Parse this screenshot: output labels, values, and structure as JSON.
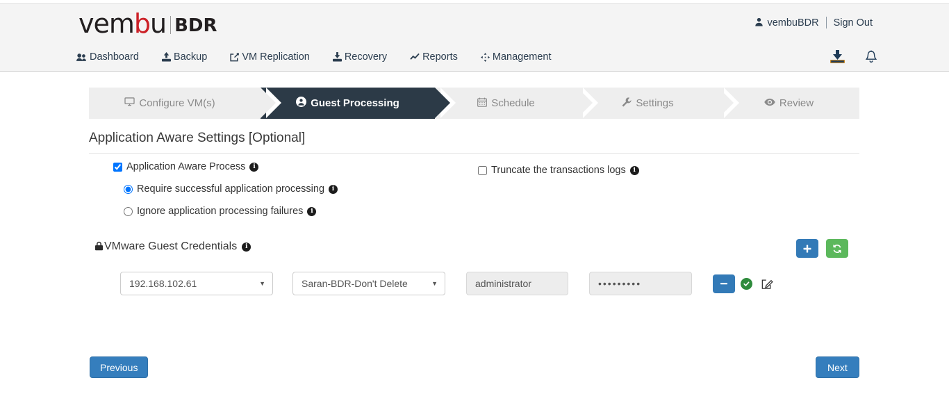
{
  "brand": {
    "name_part1": "vem",
    "name_part2": "b",
    "name_part3": "u",
    "product": "BDR"
  },
  "header": {
    "user_icon": "user-icon",
    "username": "vembuBDR",
    "sign_out": "Sign Out",
    "download_icon": "download-icon",
    "bell_icon": "bell-icon"
  },
  "nav": {
    "items": [
      {
        "label": "Dashboard",
        "icon": "dashboard-icon"
      },
      {
        "label": "Backup",
        "icon": "upload-icon"
      },
      {
        "label": "VM Replication",
        "icon": "share-icon"
      },
      {
        "label": "Recovery",
        "icon": "download-icon"
      },
      {
        "label": "Reports",
        "icon": "chart-line-icon"
      },
      {
        "label": "Management",
        "icon": "arrows-icon"
      }
    ]
  },
  "wizard": {
    "steps": [
      {
        "label": "Configure VM(s)",
        "icon": "desktop-icon",
        "active": false
      },
      {
        "label": "Guest Processing",
        "icon": "user-circle-icon",
        "active": true
      },
      {
        "label": "Schedule",
        "icon": "calendar-icon",
        "active": false
      },
      {
        "label": "Settings",
        "icon": "wrench-icon",
        "active": false
      },
      {
        "label": "Review",
        "icon": "eye-icon",
        "active": false
      }
    ]
  },
  "main": {
    "section_title": "Application Aware Settings [Optional]",
    "app_aware_process": {
      "label": "Application Aware Process",
      "checked": true,
      "info_icon": "info-icon"
    },
    "truncate_logs": {
      "label": "Truncate the transactions logs",
      "checked": false,
      "info_icon": "info-icon"
    },
    "radio_options": [
      {
        "label": "Require successful application processing",
        "selected": true,
        "info_icon": "info-icon"
      },
      {
        "label": "Ignore application processing failures",
        "selected": false,
        "info_icon": "info-icon"
      }
    ],
    "credentials": {
      "title": "VMware Guest Credentials",
      "lock_icon": "lock-icon",
      "info_icon": "info-icon",
      "add_label": "+",
      "refresh_label": "⟳",
      "rows": [
        {
          "host": "192.168.102.61",
          "credential": "Saran-BDR-Don't Delete",
          "username": "administrator",
          "password": "•••••••••",
          "remove_label": "–",
          "status_icon": "check-circle-icon",
          "edit_icon": "edit-icon"
        }
      ]
    }
  },
  "footer": {
    "previous": "Previous",
    "next": "Next"
  },
  "colors": {
    "accent_blue": "#357ebd",
    "active_step": "#2c3a47",
    "green": "#5cb85c",
    "brand_red": "#cc2027",
    "header_bg": "#f4f4f4"
  }
}
